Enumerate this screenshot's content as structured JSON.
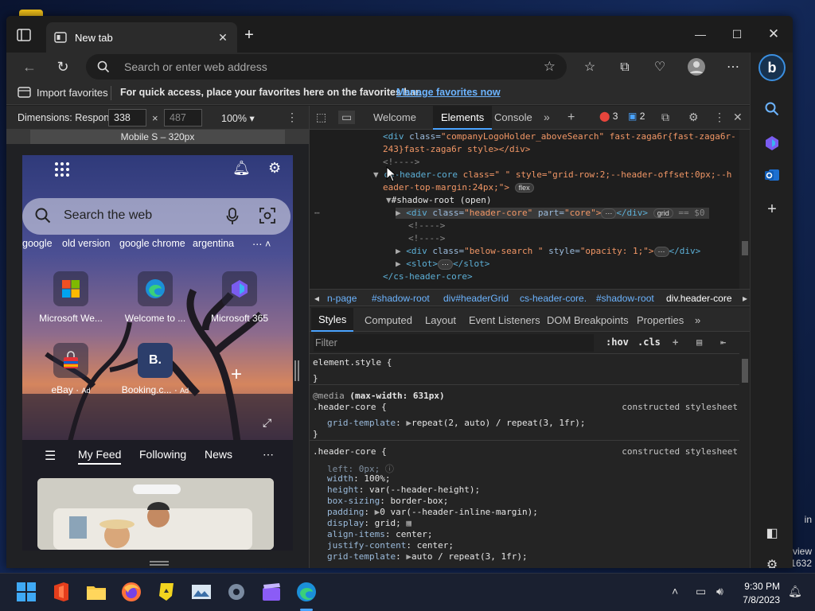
{
  "browser": {
    "tab_title": "New tab",
    "address_placeholder": "Search or enter web address",
    "favorites_bar": {
      "import_label": "Import favorites",
      "message": "For quick access, place your favorites here on the favorites bar.",
      "link": "Manage favorites now"
    }
  },
  "device_toolbar": {
    "dimensions_label": "Dimensions: Respon",
    "width": "338",
    "height_placeholder": "487",
    "times": "×",
    "zoom": "100%",
    "media_query_label": "Mobile S – 320px"
  },
  "new_tab_page": {
    "search_placeholder": "Search the web",
    "trending": [
      "google",
      "old version",
      "google chrome",
      "argentina"
    ],
    "tiles": [
      {
        "label": "Microsoft We...",
        "ad": ""
      },
      {
        "label": "Welcome to ...",
        "ad": ""
      },
      {
        "label": "Microsoft 365",
        "ad": ""
      },
      {
        "label": "eBay",
        "ad": "Ad"
      },
      {
        "label": "Booking.c...",
        "ad": "Ad"
      }
    ],
    "feed_tabs": [
      "My Feed",
      "Following",
      "News"
    ]
  },
  "devtools": {
    "tabs": [
      "Welcome",
      "Elements",
      "Console"
    ],
    "error_count": "3",
    "message_count": "2",
    "dom_lines": {
      "l1_tag": "<div",
      "l1_attr": " class=",
      "l1_val": "\"companyLogoHolder_aboveSearch\" fast-zaga6r{fast-zaga6r-",
      "l2": "243}fast-zaga6r style></div>",
      "l3": "<!---->",
      "l4_tag": "cs-header-core",
      "l4_rest": " class=\" \" style=\"grid-row:2;--header-offset:0px;--h",
      "l5": "eader-top-margin:24px;\">",
      "l5_pill": "flex",
      "l6": "#shadow-root (open)",
      "l7_tag": "<div",
      "l7_attr": " class=",
      "l7_val": "\"header-core\"",
      "l7_attr2": " part=",
      "l7_val2": "\"core\">",
      "l7_end": "</div>",
      "l7_pill": "grid",
      "l7_eq": "== $0",
      "l8": "<!---->",
      "l9": "<!---->",
      "l10_tag": "<div",
      "l10_attr": " class=",
      "l10_val": "\"below-search \"",
      "l10_attr2": " style=",
      "l10_val2": "\"opacity: 1;\">",
      "l10_end": "</div>",
      "l11": "<slot>",
      "l11_end": "</slot>",
      "l12": "</cs-header-core>"
    },
    "breadcrumbs": [
      "n-page",
      "#shadow-root",
      "div#headerGrid",
      "cs-header-core.",
      "#shadow-root",
      "div.header-core"
    ],
    "sub_tabs": [
      "Styles",
      "Computed",
      "Layout",
      "Event Listeners",
      "DOM Breakpoints",
      "Properties"
    ],
    "filter_placeholder": "Filter",
    "hov": ":hov",
    "cls": ".cls",
    "styles": {
      "element_style": "element.style {",
      "close": "}",
      "media": "@media",
      "media_cond": "(max-width: 631px)",
      "rule1_selector": ".header-core {",
      "rule1_source": "constructed stylesheet",
      "rule1_prop": "grid-template",
      "rule1_val": "repeat(2, auto) / repeat(3, 1fr);",
      "rule2_selector": ".header-core {",
      "rule2_source": "constructed stylesheet",
      "rule2_props": [
        {
          "prop": "left",
          "val": "0px;"
        },
        {
          "prop": "width",
          "val": "100%;"
        },
        {
          "prop": "height",
          "val": "var(--header-height);"
        },
        {
          "prop": "box-sizing",
          "val": "border-box;"
        },
        {
          "prop": "padding",
          "val": "0 var(--header-inline-margin);"
        },
        {
          "prop": "display",
          "val": "grid;"
        },
        {
          "prop": "align-items",
          "val": "center;"
        },
        {
          "prop": "justify-content",
          "val": "center;"
        },
        {
          "prop": "grid-template",
          "val": "auto / repeat(3, 1fr);"
        }
      ]
    }
  },
  "taskbar": {
    "time": "9:30 PM",
    "date": "7/8/2023"
  },
  "desktop_fragments": {
    "in": "in",
    "view": "view",
    "num": "1632"
  },
  "colors": {
    "accent": "#4aa3ff",
    "link": "#6cb4ff",
    "devtools_bg": "#242424"
  }
}
